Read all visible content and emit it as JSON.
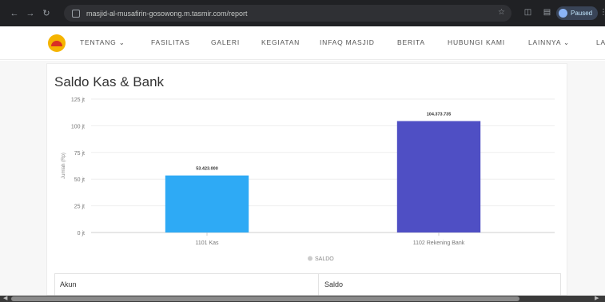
{
  "browser": {
    "url": "masjid-al-musafirin-gosowong.m.tasmir.com/report",
    "paused_label": "Paused",
    "icons": [
      "back-icon",
      "forward-icon",
      "reload-icon",
      "site-info-icon",
      "bookmark-star-icon",
      "extensions-icon",
      "side-panel-icon",
      "profile-icon",
      "menu-icon"
    ]
  },
  "nav": {
    "items": [
      "TENTANG ⌄",
      "FASILITAS",
      "GALERI",
      "KEGIATAN",
      "INFAQ MASJID",
      "BERITA",
      "HUBUNGI KAMI",
      "LAINNYA ⌄",
      "LA"
    ]
  },
  "page": {
    "title": "Saldo Kas & Bank"
  },
  "chart_data": {
    "type": "bar",
    "title": "Saldo Kas & Bank",
    "categories": [
      "1101 Kas",
      "1102 Rekening Bank"
    ],
    "series": [
      {
        "name": "SALDO",
        "values": [
          53423000,
          104373735
        ],
        "colors": [
          "#2eaaf5",
          "#4f4fc4"
        ]
      }
    ],
    "data_labels": [
      "53.423.000",
      "104.373.735"
    ],
    "ylabel": "Jumlah (Rp)",
    "y_ticks": [
      "0 jt",
      "25 jt",
      "50 jt",
      "75 jt",
      "100 jt",
      "125 jt"
    ],
    "y_tick_values": [
      0,
      25000000,
      50000000,
      75000000,
      100000000,
      125000000
    ],
    "ylim": [
      0,
      125000000
    ],
    "grid": true,
    "legend_position": "bottom"
  },
  "table": {
    "headers": [
      "Akun",
      "Saldo"
    ]
  }
}
